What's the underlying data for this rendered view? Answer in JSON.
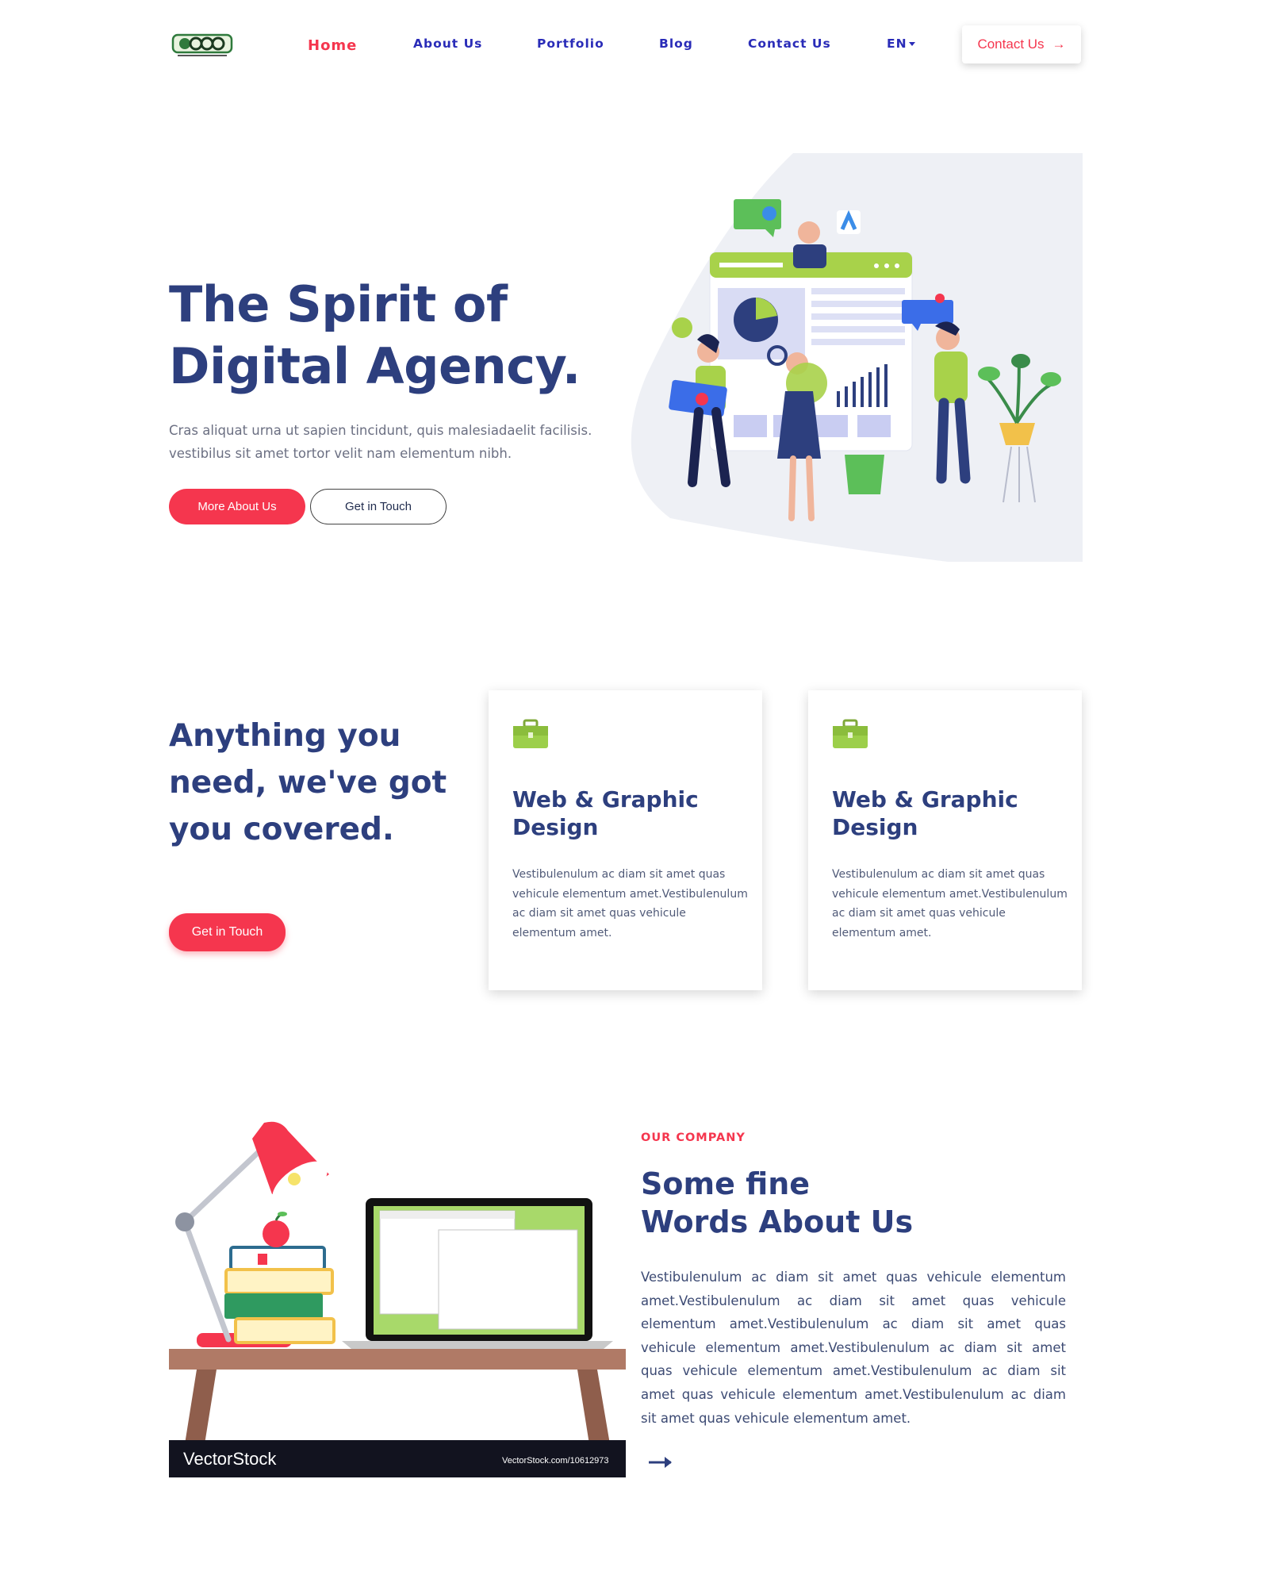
{
  "nav": {
    "logo_text": "DOOB",
    "logo_tagline": "For the High-Class Individuals",
    "links": [
      {
        "label": "Home"
      },
      {
        "label": "About Us"
      },
      {
        "label": "Portfolio"
      },
      {
        "label": "Blog"
      },
      {
        "label": "Contact Us"
      },
      {
        "label": "EN"
      }
    ],
    "cta_label": "Contact Us",
    "cta_arrow": "→"
  },
  "hero": {
    "title_line1": "The Spirit of",
    "title_line2": "Digital Agency.",
    "description": "Cras aliquat urna ut sapien tincidunt, quis malesiadaelit facilisis. vestibilus sit amet tortor velit nam elementum nibh.",
    "primary_button": "More About Us",
    "secondary_button": "Get in Touch"
  },
  "services": {
    "heading": "Anything you need, we've got you covered.",
    "button": "Get in Touch",
    "cards": [
      {
        "title": "Web & Graphic Design",
        "text": "Vestibulenulum ac diam sit amet quas vehicule elementum amet.Vestibulenulum ac diam sit amet quas vehicule elementum amet."
      },
      {
        "title": "Web & Graphic Design",
        "text": "Vestibulenulum ac diam sit amet quas vehicule elementum amet.Vestibulenulum ac diam sit amet quas vehicule elementum amet."
      }
    ],
    "icon_color": "#9ccf4a"
  },
  "about": {
    "overline": "OUR COMPANY",
    "title_line1": "Some fine",
    "title_line2": "Words About Us",
    "text": "Vestibulenulum ac diam sit amet quas vehicule elementum amet.Vestibulenulum ac diam sit amet quas vehicule elementum amet.Vestibulenulum ac diam sit amet quas vehicule elementum amet.Vestibulenulum ac diam sit amet quas vehicule elementum amet.Vestibulenulum ac diam sit amet quas vehicule elementum amet.Vestibulenulum ac diam sit amet quas vehicule elementum amet.",
    "watermark_brand": "VectorStock",
    "watermark_url": "VectorStock.com/10612973"
  },
  "colors": {
    "accent": "#f5364e",
    "heading": "#2d3f7e",
    "nav_link": "#2a2cb8"
  }
}
